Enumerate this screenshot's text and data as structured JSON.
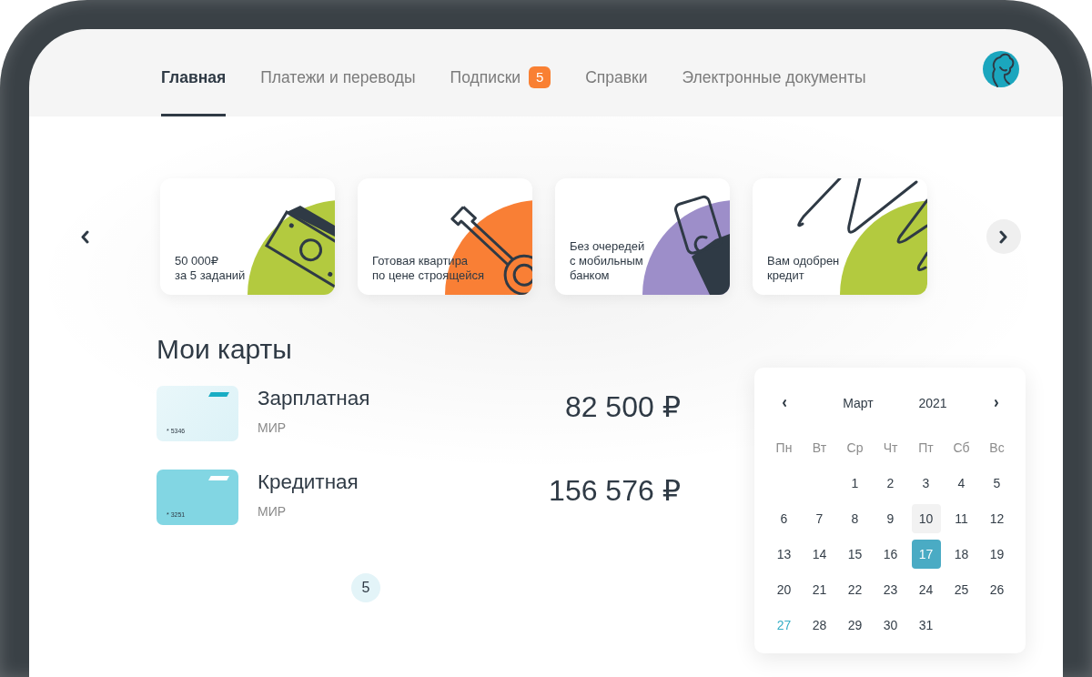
{
  "nav": {
    "tabs": [
      {
        "label": "Главная",
        "selected": true
      },
      {
        "label": "Платежи и переводы",
        "selected": false
      },
      {
        "label": "Подписки",
        "selected": false,
        "badge": "5"
      },
      {
        "label": "Справки",
        "selected": false
      },
      {
        "label": "Электронные документы",
        "selected": false
      }
    ]
  },
  "promos": [
    {
      "kind": "money",
      "color": "#b3ca3f",
      "lines": [
        "50 000₽",
        "за 5 заданий"
      ]
    },
    {
      "kind": "key",
      "color": "#f97f35",
      "lines": [
        "Готовая квартира",
        "по цене строящейся"
      ]
    },
    {
      "kind": "phone",
      "color": "#9d8ec9",
      "lines": [
        "Без очередей",
        "с мобильным",
        "банком"
      ]
    },
    {
      "kind": "scribble",
      "color": "#b3ca3f",
      "lines": [
        "Вам одобрен",
        "кредит"
      ]
    }
  ],
  "my_cards": {
    "title": "Мои карты",
    "cards": [
      {
        "kind": "pale",
        "number": "* 5346",
        "name": "Зарплатная",
        "system": "МИР",
        "balance": "82 500 ₽"
      },
      {
        "kind": "bright",
        "number": "* 3251",
        "name": "Кредитная",
        "system": "МИР",
        "balance": "156 576 ₽"
      }
    ],
    "pages": [
      {
        "label": "5",
        "selected": true
      }
    ]
  },
  "calendar": {
    "month": "Март",
    "year": "2021",
    "weekdays": [
      "Пн",
      "Вт",
      "Ср",
      "Чт",
      "Пт",
      "Сб",
      "Вс"
    ],
    "weeks": [
      [
        {
          "label": "1",
          "selected": false,
          "kind": "plain"
        },
        {
          "label": "2",
          "selected": false,
          "kind": "plain"
        },
        {
          "label": "3",
          "selected": false,
          "kind": "plain"
        },
        {
          "label": "4",
          "selected": false,
          "kind": "plain"
        },
        {
          "label": "5",
          "selected": false,
          "kind": "plain"
        }
      ],
      [
        {
          "label": "6",
          "selected": false,
          "kind": "plain"
        },
        {
          "label": "7",
          "selected": false,
          "kind": "plain"
        },
        {
          "label": "8",
          "selected": false,
          "kind": "plain"
        },
        {
          "label": "9",
          "selected": false,
          "kind": "plain"
        },
        {
          "label": "10",
          "selected": false,
          "kind": "today"
        },
        {
          "label": "11",
          "selected": false,
          "kind": "plain"
        },
        {
          "label": "12",
          "selected": false,
          "kind": "plain"
        }
      ],
      [
        {
          "label": "13",
          "selected": false,
          "kind": "plain"
        },
        {
          "label": "14",
          "selected": false,
          "kind": "plain"
        },
        {
          "label": "15",
          "selected": false,
          "kind": "plain"
        },
        {
          "label": "16",
          "selected": false,
          "kind": "plain"
        },
        {
          "label": "17",
          "selected": true,
          "kind": "plain"
        },
        {
          "label": "18",
          "selected": false,
          "kind": "plain"
        },
        {
          "label": "19",
          "selected": false,
          "kind": "plain"
        }
      ],
      [
        {
          "label": "20",
          "selected": false,
          "kind": "plain"
        },
        {
          "label": "21",
          "selected": false,
          "kind": "plain"
        },
        {
          "label": "22",
          "selected": false,
          "kind": "plain"
        },
        {
          "label": "23",
          "selected": false,
          "kind": "plain"
        },
        {
          "label": "24",
          "selected": false,
          "kind": "plain"
        },
        {
          "label": "25",
          "selected": false,
          "kind": "plain"
        },
        {
          "label": "26",
          "selected": false,
          "kind": "plain"
        }
      ],
      [
        {
          "label": "27",
          "selected": false,
          "kind": "accent"
        },
        {
          "label": "28",
          "selected": false,
          "kind": "plain"
        },
        {
          "label": "29",
          "selected": false,
          "kind": "plain"
        },
        {
          "label": "30",
          "selected": false,
          "kind": "plain"
        },
        {
          "label": "31",
          "selected": false,
          "kind": "plain"
        }
      ]
    ]
  }
}
